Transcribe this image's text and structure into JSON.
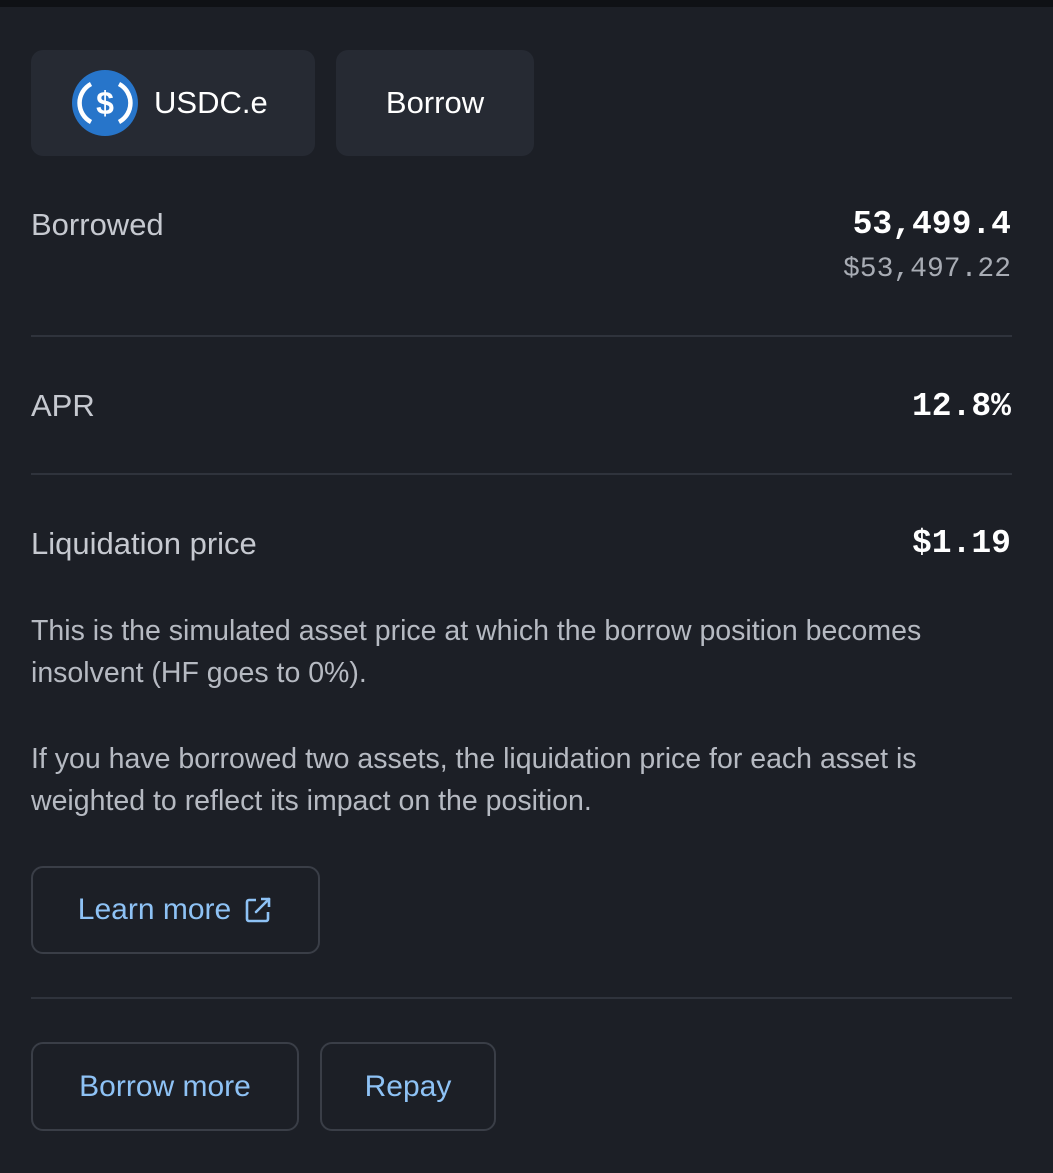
{
  "header": {
    "asset_name": "USDC.e",
    "asset_icon": "usdc-coin-icon",
    "action_label": "Borrow"
  },
  "borrowed": {
    "label": "Borrowed",
    "amount": "53,499.4",
    "usd_value": "$53,497.22"
  },
  "apr": {
    "label": "APR",
    "value": "12.8%"
  },
  "liquidation": {
    "label": "Liquidation price",
    "value": "$1.19",
    "description_1": "This is the simulated asset price at which the borrow position becomes insolvent (HF goes to 0%).",
    "description_2": "If you have borrowed two assets, the liquidation price for each asset is weighted to reflect its impact on the position.",
    "learn_more_label": "Learn more",
    "learn_more_icon": "external-link-icon"
  },
  "actions": {
    "borrow_more_label": "Borrow more",
    "repay_label": "Repay"
  },
  "colors": {
    "background": "#1c1f26",
    "chip_background": "#262a33",
    "accent_link": "#8ec2f5",
    "usdc_blue": "#2775ca"
  }
}
